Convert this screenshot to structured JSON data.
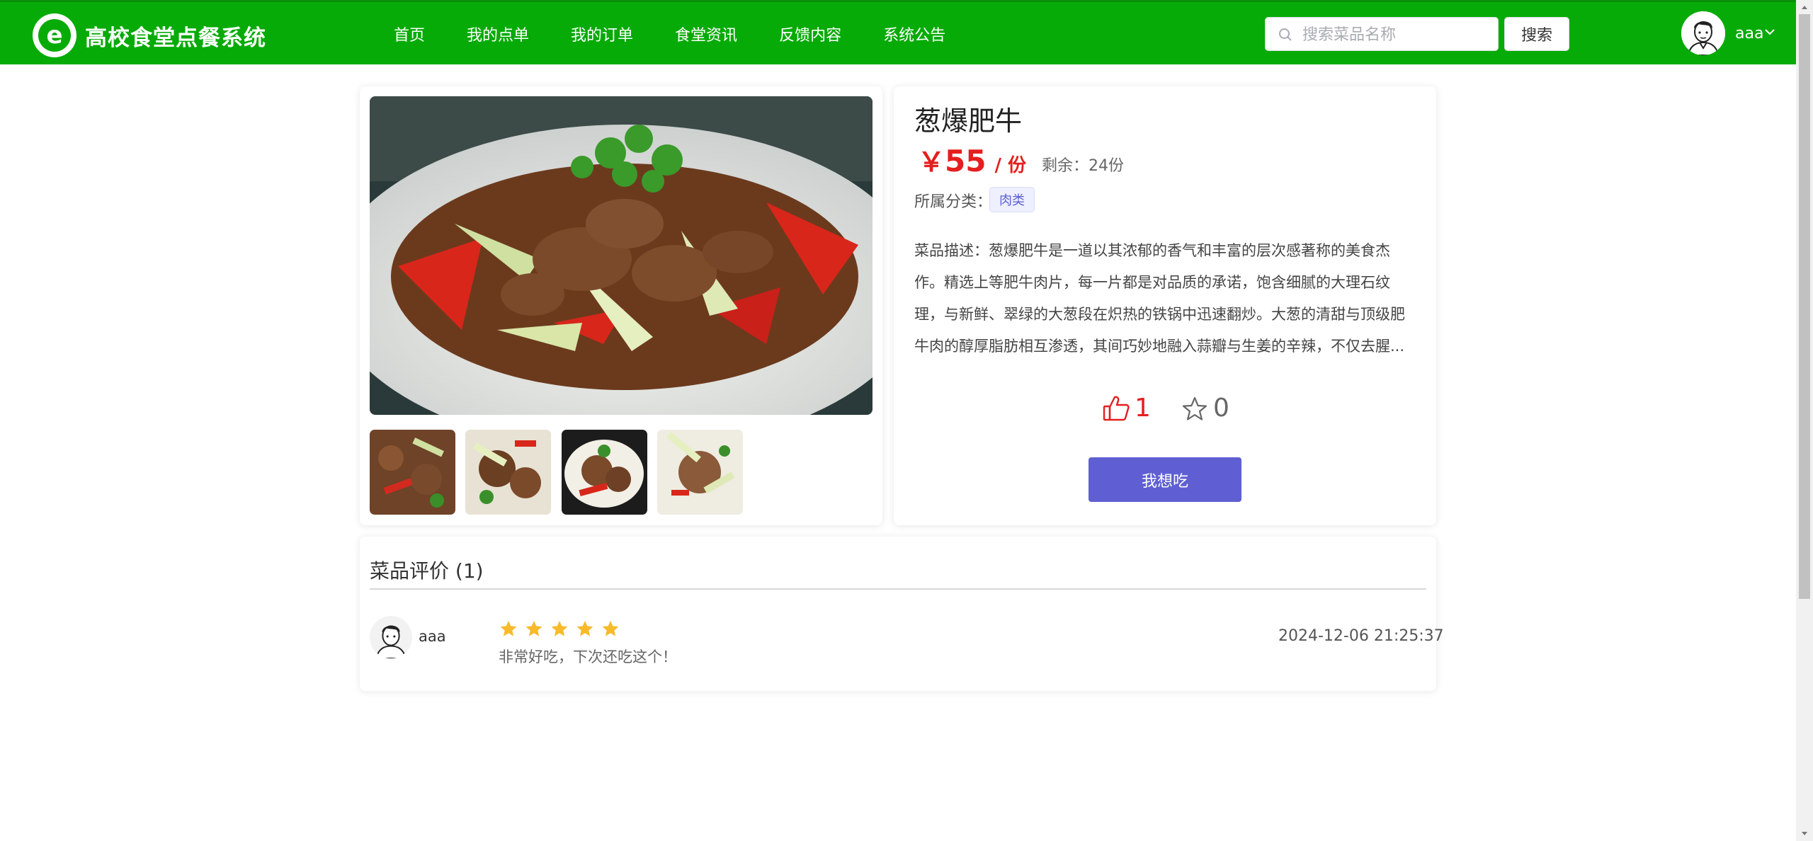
{
  "app": {
    "title": "高校食堂点餐系统",
    "logo_letter": "e"
  },
  "nav": {
    "items": [
      "首页",
      "我的点单",
      "我的订单",
      "食堂资讯",
      "反馈内容",
      "系统公告"
    ]
  },
  "search": {
    "placeholder": "搜索菜品名称",
    "value": "",
    "button_label": "搜索"
  },
  "user": {
    "name": "aaa"
  },
  "dish": {
    "name": "葱爆肥牛",
    "currency": "￥",
    "price": "55",
    "unit": "/ 份",
    "stock_label": "剩余：",
    "stock_value": "24份",
    "category_label": "所属分类：",
    "category": "肉类",
    "description": "菜品描述：葱爆肥牛是一道以其浓郁的香气和丰富的层次感著称的美食杰作。精选上等肥牛肉片，每一片都是对品质的承诺，饱含细腻的大理石纹理，与新鲜、翠绿的大葱段在炽热的铁锅中迅速翻炒。大葱的清甜与顶级肥牛肉的醇厚脂肪相互渗透，其间巧妙地融入蒜瓣与生姜的辛辣，不仅去腥...",
    "likes": "1",
    "favorites": "0",
    "want_button": "我想吃"
  },
  "reviews": {
    "title": "菜品评价 (1)",
    "items": [
      {
        "user": "aaa",
        "rating": 5,
        "text": "非常好吃，下次还吃这个！",
        "date": "2024-12-06 21:25:37"
      }
    ]
  },
  "colors": {
    "header": "#07ab07",
    "price": "#e41f1f",
    "accent": "#5f5fd3",
    "star": "#f7ba2a"
  }
}
